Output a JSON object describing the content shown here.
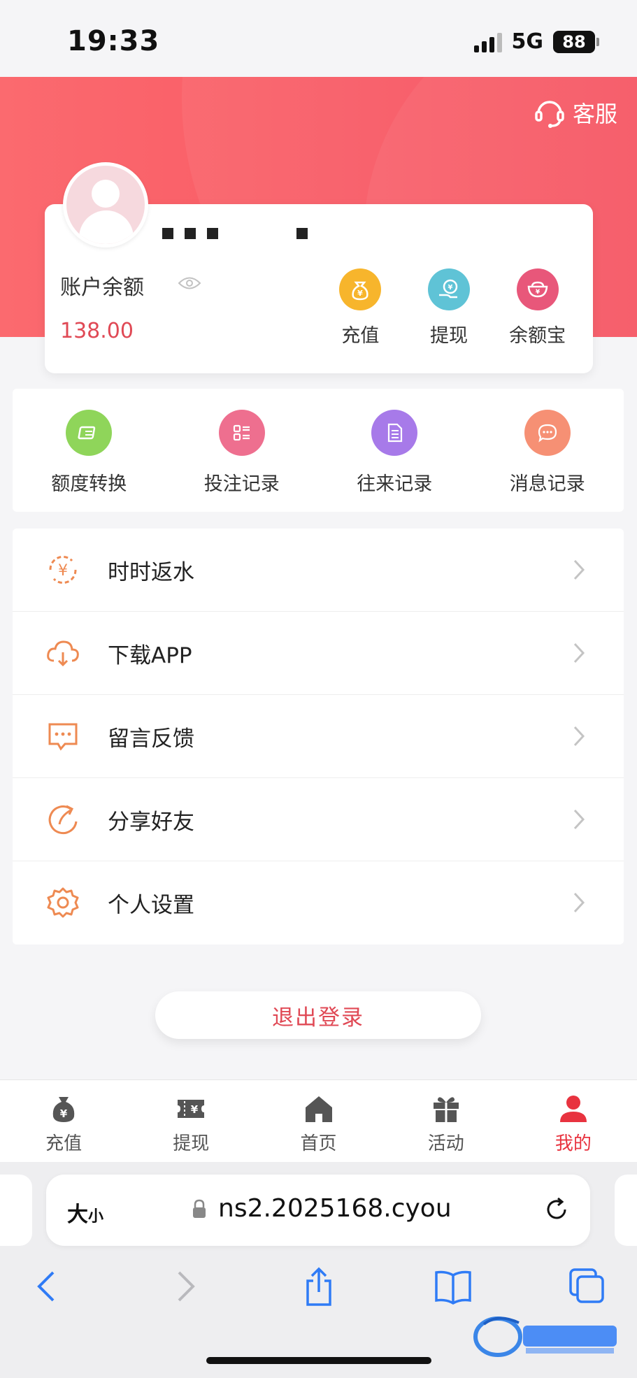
{
  "status_bar": {
    "time": "19:33",
    "network": "5G",
    "battery": "88"
  },
  "header": {
    "service_label": "客服"
  },
  "account": {
    "balance_label": "账户余额",
    "balance_value": "138.00",
    "actions": [
      {
        "label": "充值",
        "icon": "money-bag-icon",
        "color": "#f7b52c"
      },
      {
        "label": "提现",
        "icon": "withdraw-icon",
        "color": "#5fc3d6"
      },
      {
        "label": "余额宝",
        "icon": "ingot-icon",
        "color": "#e8577a"
      }
    ]
  },
  "shortcuts": [
    {
      "label": "额度转换",
      "icon": "transfer-icon",
      "color": "#8fd55a"
    },
    {
      "label": "投注记录",
      "icon": "list-icon",
      "color": "#ee6f8f"
    },
    {
      "label": "往来记录",
      "icon": "document-icon",
      "color": "#a77ae9"
    },
    {
      "label": "消息记录",
      "icon": "message-icon",
      "color": "#f69074"
    }
  ],
  "menu": [
    {
      "label": "时时返水",
      "icon": "rebate-icon"
    },
    {
      "label": "下载APP",
      "icon": "cloud-download-icon"
    },
    {
      "label": "留言反馈",
      "icon": "feedback-icon"
    },
    {
      "label": "分享好友",
      "icon": "share-icon"
    },
    {
      "label": "个人设置",
      "icon": "settings-icon"
    }
  ],
  "logout_label": "退出登录",
  "tabs": [
    {
      "label": "充值",
      "icon": "money-bag-icon",
      "active": false
    },
    {
      "label": "提现",
      "icon": "ticket-icon",
      "active": false
    },
    {
      "label": "首页",
      "icon": "home-icon",
      "active": false
    },
    {
      "label": "活动",
      "icon": "gift-icon",
      "active": false
    },
    {
      "label": "我的",
      "icon": "user-icon",
      "active": true
    }
  ],
  "browser": {
    "text_size_big": "大",
    "text_size_small": "小",
    "url": "ns2.2025168.cyou"
  },
  "colors": {
    "brand_red": "#f64d5c",
    "accent_orange": "#ee8a52",
    "active_tab": "#e8333f"
  }
}
